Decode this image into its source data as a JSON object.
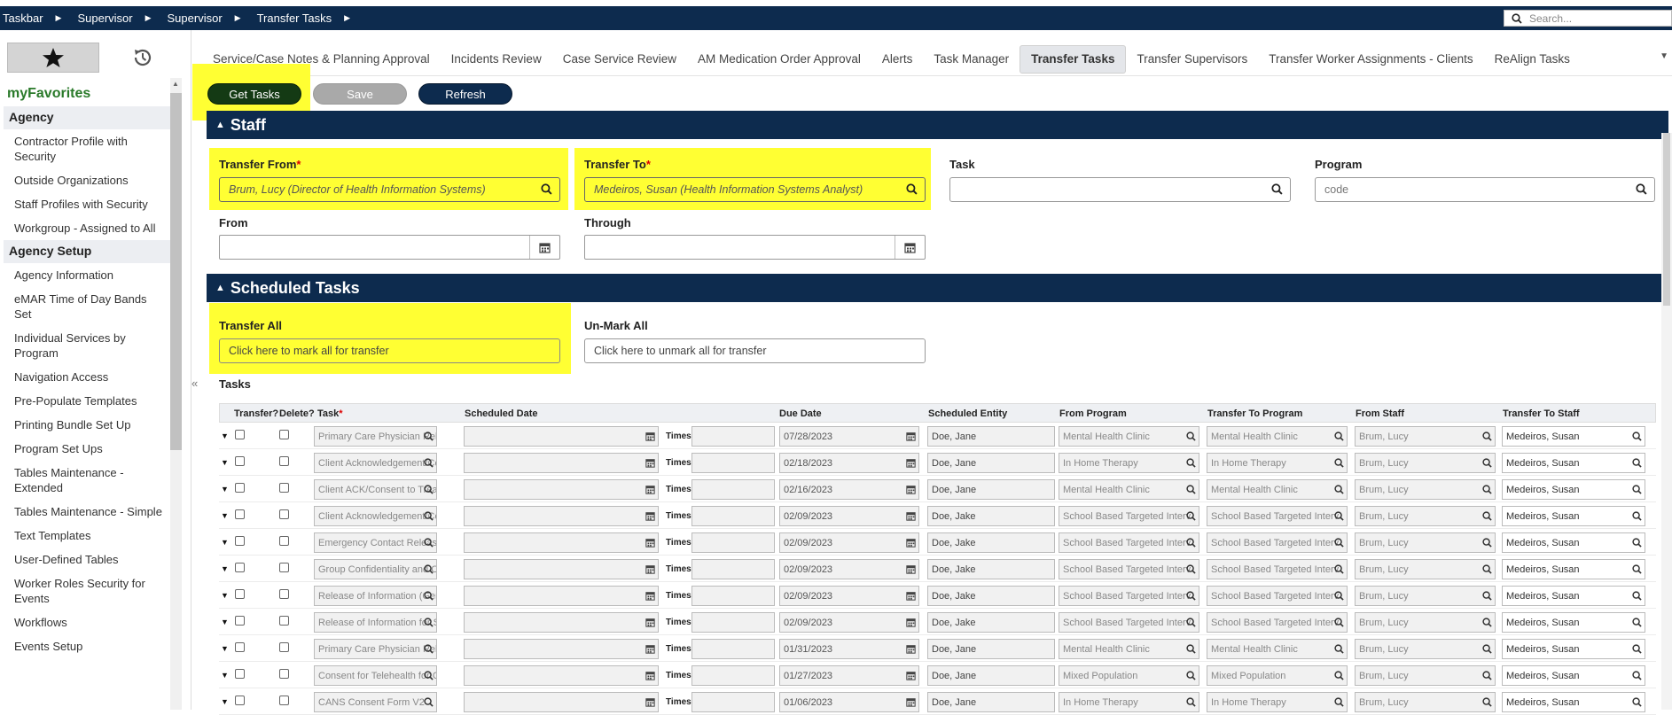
{
  "breadcrumb": [
    "Taskbar",
    "Supervisor",
    "Supervisor",
    "Transfer Tasks"
  ],
  "search": {
    "placeholder": "Search..."
  },
  "sidebar": {
    "favorites_title": "myFavorites",
    "groups": [
      {
        "title": "Agency",
        "items": [
          "Contractor Profile with Security",
          "Outside Organizations",
          "Staff Profiles with Security",
          "Workgroup - Assigned to All"
        ]
      },
      {
        "title": "Agency Setup",
        "items": [
          "Agency Information",
          "eMAR Time of Day Bands Set",
          "Individual Services by Program",
          "Navigation Access",
          "Pre-Populate Templates",
          "Printing Bundle Set Up",
          "Program Set Ups",
          "Tables Maintenance - Extended",
          "Tables Maintenance - Simple",
          "Text Templates",
          "User-Defined Tables",
          "Worker Roles Security for Events",
          "Workflows",
          "Events Setup"
        ]
      }
    ]
  },
  "tabs": [
    "Service/Case Notes & Planning Approval",
    "Incidents Review",
    "Case Service Review",
    "AM Medication Order Approval",
    "Alerts",
    "Task Manager",
    "Transfer Tasks",
    "Transfer Supervisors",
    "Transfer Worker Assignments - Clients",
    "ReAlign Tasks"
  ],
  "active_tab": "Transfer Tasks",
  "buttons": {
    "get_tasks": "Get Tasks",
    "save": "Save",
    "refresh": "Refresh"
  },
  "staff_section": {
    "title": "Staff",
    "transfer_from_label": "Transfer From",
    "transfer_from_value": "Brum, Lucy (Director of Health Information Systems)",
    "transfer_to_label": "Transfer To",
    "transfer_to_value": "Medeiros, Susan (Health Information Systems Analyst)",
    "task_label": "Task",
    "program_label": "Program",
    "program_placeholder": "code",
    "from_label": "From",
    "through_label": "Through"
  },
  "scheduled_section": {
    "title": "Scheduled Tasks",
    "transfer_all_label": "Transfer All",
    "transfer_all_text": "Click here to mark all for transfer",
    "unmark_all_label": "Un-Mark All",
    "unmark_all_text": "Click here to unmark all for transfer",
    "tasks_label": "Tasks"
  },
  "grid": {
    "headers": [
      "Transfer?",
      "Delete?",
      "Task",
      "Scheduled Date",
      "Due Date",
      "Scheduled Entity",
      "From Program",
      "Transfer To Program",
      "From Staff",
      "Transfer To Staff"
    ],
    "times_label": "Times",
    "rows": [
      {
        "task": "Primary Care Physician Relea",
        "due": "07/28/2023",
        "entity": "Doe, Jane",
        "from_prog": "Mental Health Clinic",
        "to_prog": "Mental Health Clinic",
        "from_staff": "Brum, Lucy",
        "to_staff": "Medeiros, Susan"
      },
      {
        "task": "Client Acknowledgement/Co",
        "due": "02/18/2023",
        "entity": "Doe, Jane",
        "from_prog": "In Home Therapy",
        "to_prog": "In Home Therapy",
        "from_staff": "Brum, Lucy",
        "to_staff": "Medeiros, Susan"
      },
      {
        "task": "Client ACK/Consent to Treatr",
        "due": "02/16/2023",
        "entity": "Doe, Jane",
        "from_prog": "Mental Health Clinic",
        "to_prog": "Mental Health Clinic",
        "from_staff": "Brum, Lucy",
        "to_staff": "Medeiros, Susan"
      },
      {
        "task": "Client Acknowledgement/Co",
        "due": "02/09/2023",
        "entity": "Doe, Jake",
        "from_prog": "School Based Targeted Interv",
        "to_prog": "School Based Targeted Interv",
        "from_staff": "Brum, Lucy",
        "to_staff": "Medeiros, Susan"
      },
      {
        "task": "Emergency Contact Release \\",
        "due": "02/09/2023",
        "entity": "Doe, Jake",
        "from_prog": "School Based Targeted Interv",
        "to_prog": "School Based Targeted Interv",
        "from_staff": "Brum, Lucy",
        "to_staff": "Medeiros, Susan"
      },
      {
        "task": "Group Confidentiality and Cc",
        "due": "02/09/2023",
        "entity": "Doe, Jake",
        "from_prog": "School Based Targeted Interv",
        "to_prog": "School Based Targeted Interv",
        "from_staff": "Brum, Lucy",
        "to_staff": "Medeiros, Susan"
      },
      {
        "task": "Release of Information (Gene",
        "due": "02/09/2023",
        "entity": "Doe, Jake",
        "from_prog": "School Based Targeted Interv",
        "to_prog": "School Based Targeted Interv",
        "from_staff": "Brum, Lucy",
        "to_staff": "Medeiros, Susan"
      },
      {
        "task": "Release of Information for Sc",
        "due": "02/09/2023",
        "entity": "Doe, Jake",
        "from_prog": "School Based Targeted Interv",
        "to_prog": "School Based Targeted Interv",
        "from_staff": "Brum, Lucy",
        "to_staff": "Medeiros, Susan"
      },
      {
        "task": "Primary Care Physician Relea",
        "due": "01/31/2023",
        "entity": "Doe, Jane",
        "from_prog": "Mental Health Clinic",
        "to_prog": "Mental Health Clinic",
        "from_staff": "Brum, Lucy",
        "to_staff": "Medeiros, Susan"
      },
      {
        "task": "Consent for Telehealth for Gr",
        "due": "01/27/2023",
        "entity": "Doe, Jane",
        "from_prog": "Mixed Population",
        "to_prog": "Mixed Population",
        "from_staff": "Brum, Lucy",
        "to_staff": "Medeiros, Susan"
      },
      {
        "task": "CANS Consent Form V2",
        "due": "01/06/2023",
        "entity": "Doe, Jane",
        "from_prog": "In Home Therapy",
        "to_prog": "In Home Therapy",
        "from_staff": "Brum, Lucy",
        "to_staff": "Medeiros, Susan"
      }
    ]
  },
  "colors": {
    "navy": "#0d2b4e",
    "highlight": "#ffff33",
    "get_tasks_bg": "#143a14",
    "save_bg": "#a9a9a9",
    "favorites_green": "#2a7a2a"
  }
}
